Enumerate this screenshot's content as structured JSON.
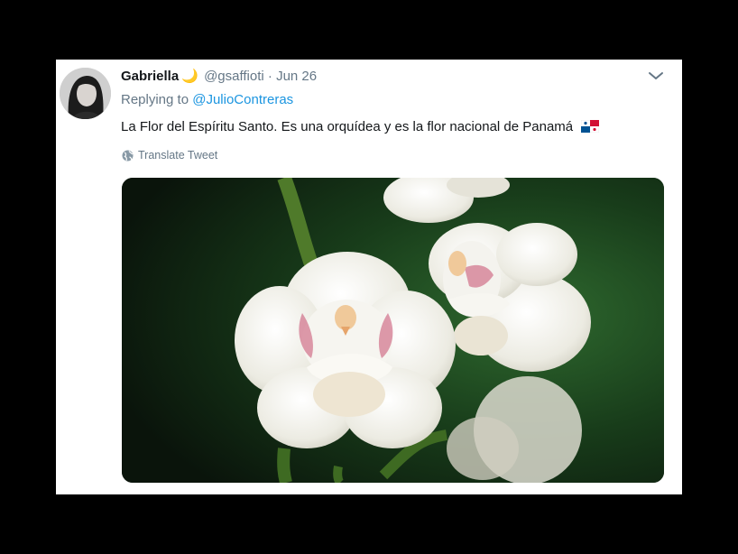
{
  "tweet": {
    "display_name": "Gabriella",
    "name_emoji": "🌙",
    "handle": "@gsaffioti",
    "separator": " · ",
    "date": "Jun 26",
    "replying_prefix": "Replying to ",
    "replying_to": "@JulioContreras",
    "text": "La Flor del Espíritu Santo. Es una orquídea y es la flor nacional de Panamá",
    "flag_icon": "panama-flag-icon",
    "translate_label": "Translate Tweet"
  },
  "colors": {
    "name": "#14171a",
    "muted": "#657786",
    "link": "#1b95e0",
    "background": "#000000",
    "card": "#ffffff"
  }
}
